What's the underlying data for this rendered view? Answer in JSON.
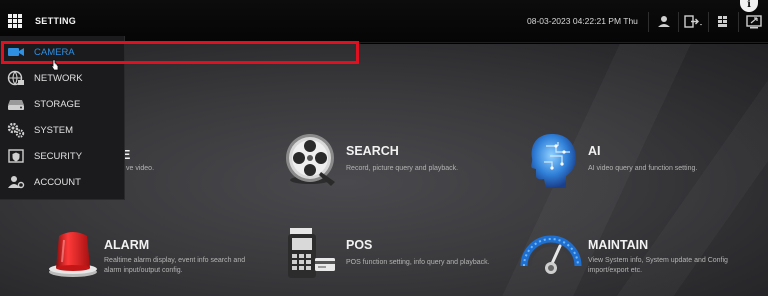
{
  "header": {
    "title": "SETTING",
    "datetime": "08-03-2023 04:22:21 PM Thu",
    "icons": [
      "grid-menu-icon",
      "user-icon",
      "logout-icon",
      "layout-icon",
      "screen-icon",
      "info-icon"
    ],
    "info_glyph": "i"
  },
  "sidebar": {
    "items": [
      {
        "label": "CAMERA",
        "icon": "camera-icon",
        "active": true
      },
      {
        "label": "NETWORK",
        "icon": "network-icon"
      },
      {
        "label": "STORAGE",
        "icon": "storage-icon"
      },
      {
        "label": "SYSTEM",
        "icon": "system-gears-icon"
      },
      {
        "label": "SECURITY",
        "icon": "shield-icon"
      },
      {
        "label": "ACCOUNT",
        "icon": "account-icon"
      }
    ]
  },
  "tiles": {
    "live": {
      "title_visible": "E",
      "desc_visible": "ve video."
    },
    "search": {
      "title": "SEARCH",
      "desc": "Record, picture query and playback."
    },
    "ai": {
      "title": "AI",
      "desc": "AI video query and function setting."
    },
    "alarm": {
      "title": "ALARM",
      "desc_line1": "Realtime alarm display, event info search and",
      "desc_line2": "alarm input/output config."
    },
    "pos": {
      "title": "POS",
      "desc": "POS function setting, info query and playback."
    },
    "maintain": {
      "title": "MAINTAIN",
      "desc_line1": "View System info, System update and Config",
      "desc_line2": "import/export etc."
    }
  },
  "colors": {
    "accent": "#2f8fe0",
    "highlight": "#e01020"
  }
}
